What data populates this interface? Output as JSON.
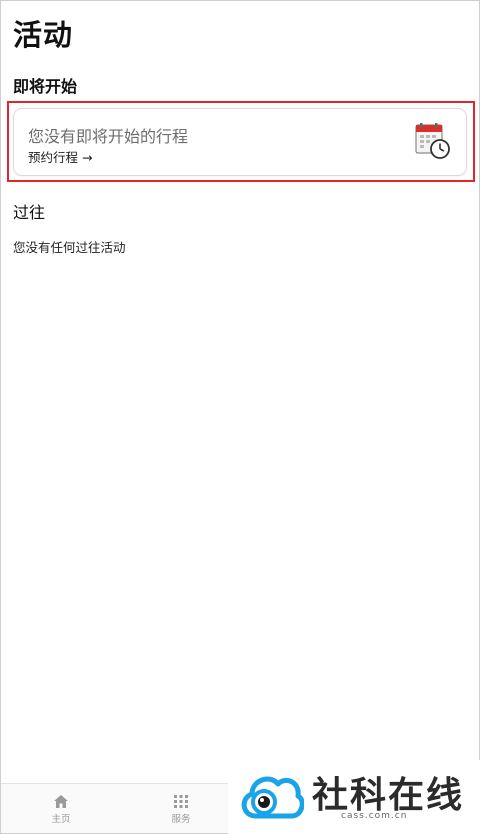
{
  "page": {
    "title": "活动"
  },
  "upcoming": {
    "heading": "即将开始",
    "card": {
      "title": "您没有即将开始的行程",
      "link": "预约行程 →",
      "icon": "calendar-clock-icon"
    }
  },
  "past": {
    "heading": "过往",
    "empty": "您没有任何过往活动"
  },
  "tabbar": {
    "items": [
      {
        "label": "主页",
        "icon": "home-icon"
      },
      {
        "label": "服务",
        "icon": "grid-icon"
      }
    ]
  },
  "watermark": {
    "name": "社科在线",
    "domain": "cass.com.cn"
  },
  "colors": {
    "highlight": "#e0262a",
    "watermark_blue": "#1aa3e8"
  }
}
